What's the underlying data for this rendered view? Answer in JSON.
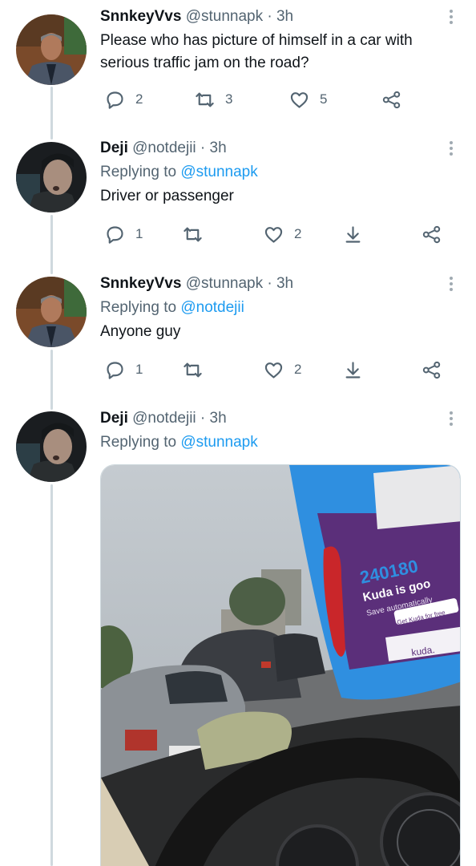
{
  "tweets": [
    {
      "name": "SnnkeyVvs",
      "handle": "@stunnapk",
      "dot": "·",
      "time": "3h",
      "text_line1": "Please who has picture of himself in a car with",
      "text_line2": "serious traffic jam on the road?",
      "reply_count": "2",
      "retweet_count": "3",
      "like_count": "5"
    },
    {
      "name": "Deji",
      "handle": "@notdejii",
      "dot": "·",
      "time": "3h",
      "replying_prefix": "Replying to",
      "replying_to": "@stunnapk",
      "text_line1": "Driver or passenger",
      "reply_count": "1",
      "retweet_count": "",
      "like_count": "2"
    },
    {
      "name": "SnnkeyVvs",
      "handle": "@stunnapk",
      "dot": "·",
      "time": "3h",
      "replying_prefix": "Replying to",
      "replying_to": "@notdejii",
      "text_line1": "Anyone guy",
      "reply_count": "1",
      "retweet_count": "",
      "like_count": "2"
    },
    {
      "name": "Deji",
      "handle": "@notdejii",
      "dot": "·",
      "time": "3h",
      "replying_prefix": "Replying to",
      "replying_to": "@stunnapk"
    }
  ],
  "media": {
    "bus_number": "240180",
    "bus_headline": "Kuda is goo",
    "bus_sub": "Save automatically",
    "bus_cta": "Get Kuda for free",
    "bus_logo": "kuda."
  },
  "icons": {
    "reply": "reply-icon",
    "retweet": "retweet-icon",
    "like": "like-icon",
    "download": "download-icon",
    "share": "share-icon",
    "more": "more-icon"
  },
  "colors": {
    "link": "#1d9bf0",
    "muted": "#536471",
    "thread": "#cfd9de"
  }
}
